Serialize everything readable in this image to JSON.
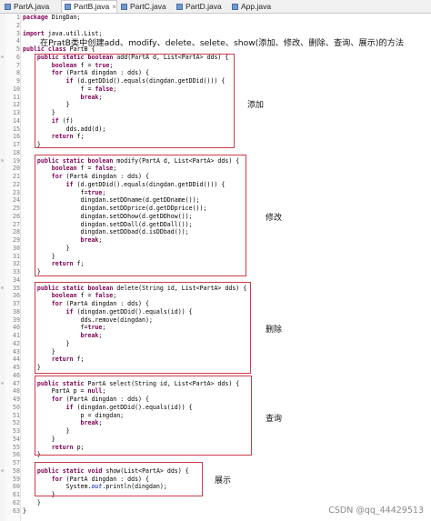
{
  "tabs": [
    {
      "label": "PartA.java",
      "active": false
    },
    {
      "label": "PartB.java",
      "active": true
    },
    {
      "label": "PartC.java",
      "active": false
    },
    {
      "label": "PartD.java",
      "active": false
    },
    {
      "label": "App.java",
      "active": false
    }
  ],
  "close_glyph": "×",
  "note": "在PratB类中创建add、modify、delete、selete、show(添加、修改、删除、查询、展示)的方法",
  "annotations": {
    "add": "添加",
    "modify": "修改",
    "delete": "删除",
    "select": "查询",
    "show": "展示"
  },
  "watermark": "CSDN @qq_44429513",
  "colors": {
    "keyword": "#7f0055",
    "field": "#0000c0",
    "box": "#cc3b4a"
  },
  "lines": [
    {
      "n": "1",
      "fold": "",
      "tokens": [
        [
          "k",
          "package"
        ],
        [
          "p",
          " DingDan;"
        ]
      ]
    },
    {
      "n": "2",
      "fold": "",
      "tokens": []
    },
    {
      "n": "3",
      "fold": "",
      "tokens": [
        [
          "k",
          "import"
        ],
        [
          "p",
          " java.util.List;"
        ]
      ]
    },
    {
      "n": "4",
      "fold": "",
      "tokens": []
    },
    {
      "n": "5",
      "fold": "",
      "tokens": [
        [
          "k",
          "public"
        ],
        [
          "p",
          " "
        ],
        [
          "k",
          "class"
        ],
        [
          "p",
          " PartB {"
        ]
      ]
    },
    {
      "n": "6",
      "fold": "⊖",
      "tokens": [
        [
          "p",
          "    "
        ],
        [
          "k",
          "public"
        ],
        [
          "p",
          " "
        ],
        [
          "k",
          "static"
        ],
        [
          "p",
          " "
        ],
        [
          "k",
          "boolean"
        ],
        [
          "p",
          " add(PartA d, List<PartA> dds) {"
        ]
      ]
    },
    {
      "n": "7",
      "fold": "",
      "tokens": [
        [
          "p",
          "        "
        ],
        [
          "k",
          "boolean"
        ],
        [
          "p",
          " f = "
        ],
        [
          "k",
          "true"
        ],
        [
          "p",
          ";"
        ]
      ]
    },
    {
      "n": "8",
      "fold": "",
      "tokens": [
        [
          "p",
          "        "
        ],
        [
          "k",
          "for"
        ],
        [
          "p",
          " (PartA dingdan : dds) {"
        ]
      ]
    },
    {
      "n": "9",
      "fold": "",
      "tokens": [
        [
          "p",
          "            "
        ],
        [
          "k",
          "if"
        ],
        [
          "p",
          " (d.getDDid().equals(dingdan.getDDid())) {"
        ]
      ]
    },
    {
      "n": "10",
      "fold": "",
      "tokens": [
        [
          "p",
          "                f = "
        ],
        [
          "k",
          "false"
        ],
        [
          "p",
          ";"
        ]
      ]
    },
    {
      "n": "11",
      "fold": "",
      "tokens": [
        [
          "p",
          "                "
        ],
        [
          "k",
          "break"
        ],
        [
          "p",
          ";"
        ]
      ]
    },
    {
      "n": "12",
      "fold": "",
      "tokens": [
        [
          "p",
          "            }"
        ]
      ]
    },
    {
      "n": "13",
      "fold": "",
      "tokens": [
        [
          "p",
          "        }"
        ]
      ]
    },
    {
      "n": "14",
      "fold": "",
      "tokens": [
        [
          "p",
          "        "
        ],
        [
          "k",
          "if"
        ],
        [
          "p",
          " (f)"
        ]
      ]
    },
    {
      "n": "15",
      "fold": "",
      "tokens": [
        [
          "p",
          "            dds.add(d);"
        ]
      ]
    },
    {
      "n": "16",
      "fold": "",
      "tokens": [
        [
          "p",
          "        "
        ],
        [
          "k",
          "return"
        ],
        [
          "p",
          " f;"
        ]
      ]
    },
    {
      "n": "17",
      "fold": "",
      "tokens": [
        [
          "p",
          "    }"
        ]
      ]
    },
    {
      "n": "18",
      "fold": "",
      "tokens": []
    },
    {
      "n": "19",
      "fold": "⊖",
      "tokens": [
        [
          "p",
          "    "
        ],
        [
          "k",
          "public"
        ],
        [
          "p",
          " "
        ],
        [
          "k",
          "static"
        ],
        [
          "p",
          " "
        ],
        [
          "k",
          "boolean"
        ],
        [
          "p",
          " modify(PartA d, List<PartA> dds) {"
        ]
      ]
    },
    {
      "n": "20",
      "fold": "",
      "tokens": [
        [
          "p",
          "        "
        ],
        [
          "k",
          "boolean"
        ],
        [
          "p",
          " f = "
        ],
        [
          "k",
          "false"
        ],
        [
          "p",
          ";"
        ]
      ]
    },
    {
      "n": "21",
      "fold": "",
      "tokens": [
        [
          "p",
          "        "
        ],
        [
          "k",
          "for"
        ],
        [
          "p",
          " (PartA dingdan : dds) {"
        ]
      ]
    },
    {
      "n": "22",
      "fold": "",
      "tokens": [
        [
          "p",
          "            "
        ],
        [
          "k",
          "if"
        ],
        [
          "p",
          " (d.getDDid().equals(dingdan.getDDid())) {"
        ]
      ]
    },
    {
      "n": "23",
      "fold": "",
      "tokens": [
        [
          "p",
          "                f="
        ],
        [
          "k",
          "true"
        ],
        [
          "p",
          ";"
        ]
      ]
    },
    {
      "n": "24",
      "fold": "",
      "tokens": [
        [
          "p",
          "                dingdan.setDDname(d.getDDname());"
        ]
      ]
    },
    {
      "n": "25",
      "fold": "",
      "tokens": [
        [
          "p",
          "                dingdan.setDDprice(d.getDDprice());"
        ]
      ]
    },
    {
      "n": "26",
      "fold": "",
      "tokens": [
        [
          "p",
          "                dingdan.setDDhow(d.getDDhow());"
        ]
      ]
    },
    {
      "n": "27",
      "fold": "",
      "tokens": [
        [
          "p",
          "                dingdan.setDDall(d.getDDall());"
        ]
      ]
    },
    {
      "n": "28",
      "fold": "",
      "tokens": [
        [
          "p",
          "                dingdan.setDDbad(d.isDDbad());"
        ]
      ]
    },
    {
      "n": "29",
      "fold": "",
      "tokens": [
        [
          "p",
          "                "
        ],
        [
          "k",
          "break"
        ],
        [
          "p",
          ";"
        ]
      ]
    },
    {
      "n": "30",
      "fold": "",
      "tokens": [
        [
          "p",
          "            }"
        ]
      ]
    },
    {
      "n": "31",
      "fold": "",
      "tokens": [
        [
          "p",
          "        }"
        ]
      ]
    },
    {
      "n": "32",
      "fold": "",
      "tokens": [
        [
          "p",
          "        "
        ],
        [
          "k",
          "return"
        ],
        [
          "p",
          " f;"
        ]
      ]
    },
    {
      "n": "33",
      "fold": "",
      "tokens": [
        [
          "p",
          "    }"
        ]
      ]
    },
    {
      "n": "34",
      "fold": "",
      "tokens": []
    },
    {
      "n": "35",
      "fold": "⊖",
      "tokens": [
        [
          "p",
          "    "
        ],
        [
          "k",
          "public"
        ],
        [
          "p",
          " "
        ],
        [
          "k",
          "static"
        ],
        [
          "p",
          " "
        ],
        [
          "k",
          "boolean"
        ],
        [
          "p",
          " delete(String id, List<PartA> dds) {"
        ]
      ]
    },
    {
      "n": "36",
      "fold": "",
      "tokens": [
        [
          "p",
          "        "
        ],
        [
          "k",
          "boolean"
        ],
        [
          "p",
          " f = "
        ],
        [
          "k",
          "false"
        ],
        [
          "p",
          ";"
        ]
      ]
    },
    {
      "n": "37",
      "fold": "",
      "tokens": [
        [
          "p",
          "        "
        ],
        [
          "k",
          "for"
        ],
        [
          "p",
          " (PartA dingdan : dds) {"
        ]
      ]
    },
    {
      "n": "38",
      "fold": "",
      "tokens": [
        [
          "p",
          "            "
        ],
        [
          "k",
          "if"
        ],
        [
          "p",
          " (dingdan.getDDid().equals(id)) {"
        ]
      ]
    },
    {
      "n": "39",
      "fold": "",
      "tokens": [
        [
          "p",
          "                dds.remove(dingdan);"
        ]
      ]
    },
    {
      "n": "40",
      "fold": "",
      "tokens": [
        [
          "p",
          "                f="
        ],
        [
          "k",
          "true"
        ],
        [
          "p",
          ";"
        ]
      ]
    },
    {
      "n": "41",
      "fold": "",
      "tokens": [
        [
          "p",
          "                "
        ],
        [
          "k",
          "break"
        ],
        [
          "p",
          ";"
        ]
      ]
    },
    {
      "n": "42",
      "fold": "",
      "tokens": [
        [
          "p",
          "            }"
        ]
      ]
    },
    {
      "n": "43",
      "fold": "",
      "tokens": [
        [
          "p",
          "        }"
        ]
      ]
    },
    {
      "n": "44",
      "fold": "",
      "tokens": [
        [
          "p",
          "        "
        ],
        [
          "k",
          "return"
        ],
        [
          "p",
          " f;"
        ]
      ]
    },
    {
      "n": "45",
      "fold": "",
      "tokens": [
        [
          "p",
          "    }"
        ]
      ]
    },
    {
      "n": "46",
      "fold": "",
      "tokens": []
    },
    {
      "n": "47",
      "fold": "⊖",
      "tokens": [
        [
          "p",
          "    "
        ],
        [
          "k",
          "public"
        ],
        [
          "p",
          " "
        ],
        [
          "k",
          "static"
        ],
        [
          "p",
          " PartA select(String id, List<PartA> dds) {"
        ]
      ]
    },
    {
      "n": "48",
      "fold": "",
      "tokens": [
        [
          "p",
          "        PartA p = "
        ],
        [
          "k",
          "null"
        ],
        [
          "p",
          ";"
        ]
      ]
    },
    {
      "n": "49",
      "fold": "",
      "tokens": [
        [
          "p",
          "        "
        ],
        [
          "k",
          "for"
        ],
        [
          "p",
          " (PartA dingdan : dds) {"
        ]
      ]
    },
    {
      "n": "50",
      "fold": "",
      "tokens": [
        [
          "p",
          "            "
        ],
        [
          "k",
          "if"
        ],
        [
          "p",
          " (dingdan.getDDid().equals(id)) {"
        ]
      ]
    },
    {
      "n": "51",
      "fold": "",
      "tokens": [
        [
          "p",
          "                p = dingdan;"
        ]
      ]
    },
    {
      "n": "52",
      "fold": "",
      "tokens": [
        [
          "p",
          "                "
        ],
        [
          "k",
          "break"
        ],
        [
          "p",
          ";"
        ]
      ]
    },
    {
      "n": "53",
      "fold": "",
      "tokens": [
        [
          "p",
          "            }"
        ]
      ]
    },
    {
      "n": "54",
      "fold": "",
      "tokens": [
        [
          "p",
          "        }"
        ]
      ]
    },
    {
      "n": "55",
      "fold": "",
      "tokens": [
        [
          "p",
          "        "
        ],
        [
          "k",
          "return"
        ],
        [
          "p",
          " p;"
        ]
      ]
    },
    {
      "n": "56",
      "fold": "",
      "tokens": [
        [
          "p",
          "    }"
        ]
      ]
    },
    {
      "n": "57",
      "fold": "",
      "tokens": []
    },
    {
      "n": "58",
      "fold": "⊖",
      "tokens": [
        [
          "p",
          "    "
        ],
        [
          "k",
          "public"
        ],
        [
          "p",
          " "
        ],
        [
          "k",
          "static"
        ],
        [
          "p",
          " "
        ],
        [
          "k",
          "void"
        ],
        [
          "p",
          " show(List<PartA> dds) {"
        ]
      ]
    },
    {
      "n": "59",
      "fold": "",
      "tokens": [
        [
          "p",
          "        "
        ],
        [
          "k",
          "for"
        ],
        [
          "p",
          " (PartA dingdan : dds) {"
        ]
      ]
    },
    {
      "n": "60",
      "fold": "",
      "tokens": [
        [
          "p",
          "            System."
        ],
        [
          "f",
          "out"
        ],
        [
          "p",
          ".println(dingdan);"
        ]
      ]
    },
    {
      "n": "61",
      "fold": "",
      "tokens": [
        [
          "p",
          "        }"
        ]
      ]
    },
    {
      "n": "62",
      "fold": "",
      "tokens": [
        [
          "p",
          "    }"
        ]
      ]
    },
    {
      "n": "63",
      "fold": "",
      "tokens": [
        [
          "p",
          "}"
        ]
      ]
    }
  ]
}
